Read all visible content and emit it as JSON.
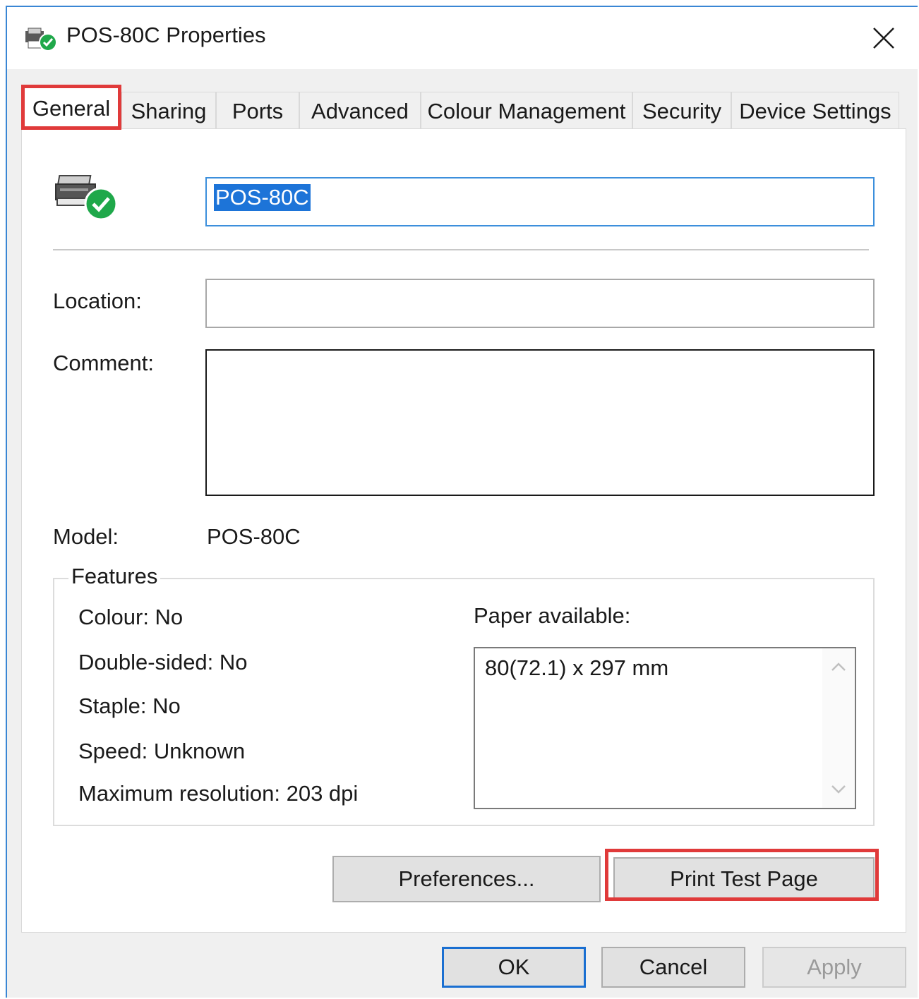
{
  "window": {
    "title": "POS-80C Properties",
    "title_icon": "printer-check-icon",
    "close_icon": "close-icon"
  },
  "tabs": [
    {
      "label": "General",
      "active": true
    },
    {
      "label": "Sharing",
      "active": false
    },
    {
      "label": "Ports",
      "active": false
    },
    {
      "label": "Advanced",
      "active": false
    },
    {
      "label": "Colour Management",
      "active": false
    },
    {
      "label": "Security",
      "active": false
    },
    {
      "label": "Device Settings",
      "active": false
    }
  ],
  "general": {
    "printer_icon": "printer-ready-icon",
    "printer_name": "POS-80C",
    "location_label": "Location:",
    "location_value": "",
    "comment_label": "Comment:",
    "comment_value": "",
    "model_label": "Model:",
    "model_value": "POS-80C"
  },
  "features": {
    "legend": "Features",
    "colour": "Colour: No",
    "double_sided": "Double-sided: No",
    "staple": "Staple: No",
    "speed": "Speed: Unknown",
    "max_resolution": "Maximum resolution: 203 dpi",
    "paper_label": "Paper available:",
    "paper_items": [
      "80(72.1) x 297 mm"
    ]
  },
  "buttons": {
    "preferences": "Preferences...",
    "print_test_page": "Print Test Page",
    "ok": "OK",
    "cancel": "Cancel",
    "apply": "Apply"
  },
  "colors": {
    "highlight": "#e03a3a",
    "selection": "#1d74d8",
    "focus_border": "#1a6fd1",
    "status_green": "#1fa84a"
  }
}
